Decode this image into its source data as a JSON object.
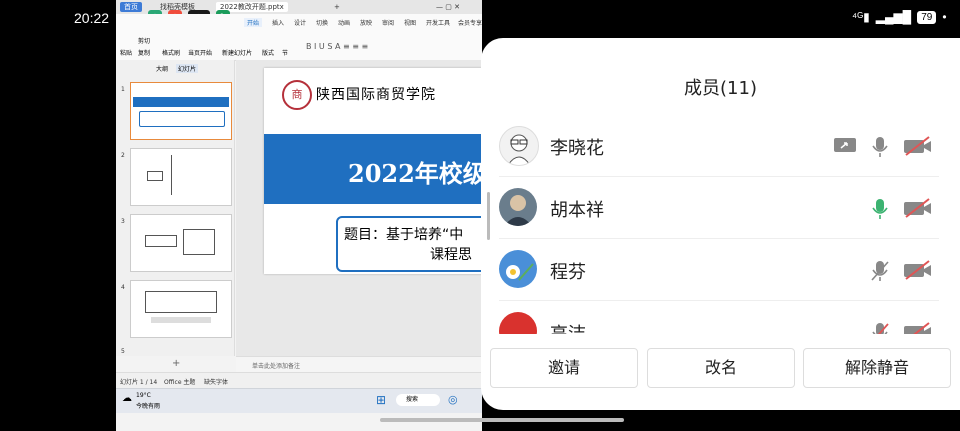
{
  "status": {
    "time": "20:22",
    "battery": "79"
  },
  "app": {
    "tabs": [
      "首页",
      "找稻壳模板",
      "2022教改开题.pptx"
    ],
    "menu": [
      "开始",
      "插入",
      "设计",
      "切换",
      "动画",
      "放映",
      "审阅",
      "视图",
      "开发工具",
      "会员专享",
      "查找命令、搜索模板"
    ],
    "ribbon_labels": [
      "粘贴",
      "剪切",
      "复制",
      "格式刷",
      "当页开始",
      "新建幻灯片",
      "版式",
      "节"
    ],
    "panel_tabs": [
      "大纲",
      "幻灯片"
    ],
    "slide_numbers": [
      "1",
      "2",
      "3",
      "4",
      "5"
    ],
    "slide": {
      "school": "陕西国际商贸学院",
      "title": "2022年校级",
      "subtitle_line1": "题目：基于培养“中",
      "subtitle_line2": "课程思"
    },
    "notes_placeholder": "单击此处添加备注",
    "statusline": {
      "slide_count": "幻灯片 1 / 14",
      "theme": "Office 主题",
      "font_missing": "缺失字体"
    },
    "taskbar": {
      "weather_temp": "19°C",
      "weather_desc": "今晚有雨",
      "search": "搜索"
    }
  },
  "panel": {
    "title": "成员(11)",
    "members": [
      {
        "name": "李晓花",
        "sharing": true,
        "mic": "off-gray",
        "video": "off"
      },
      {
        "name": "胡本祥",
        "sharing": false,
        "mic": "on",
        "video": "off"
      },
      {
        "name": "程芬",
        "sharing": false,
        "mic": "muted",
        "video": "off"
      },
      {
        "name": "高洁",
        "sharing": false,
        "mic": "muted-red",
        "video": "off"
      }
    ],
    "buttons": {
      "invite": "邀请",
      "rename": "改名",
      "unmute_all": "解除静音"
    }
  },
  "colors": {
    "accent_blue": "#1f6fc0",
    "mic_green": "#3cb371",
    "mute_red": "#e05555"
  }
}
